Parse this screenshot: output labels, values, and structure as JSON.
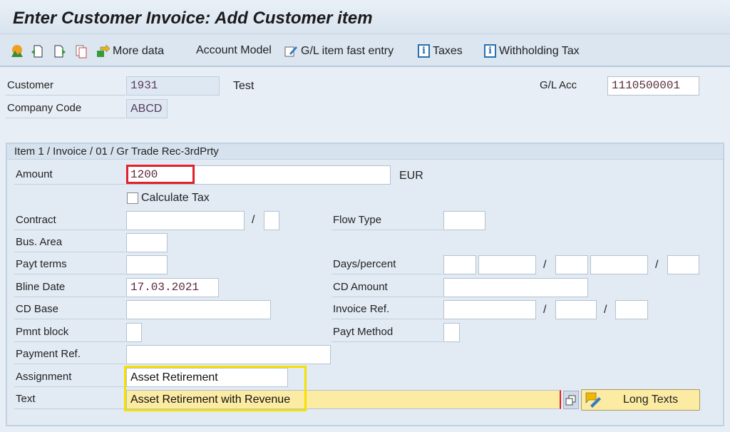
{
  "title": "Enter Customer Invoice: Add Customer item",
  "toolbar": {
    "more_data": "More data",
    "account_model": "Account Model",
    "gl_fast": "G/L item fast entry",
    "taxes": "Taxes",
    "withholding": "Withholding Tax"
  },
  "header": {
    "customer_label": "Customer",
    "customer_value": "1931",
    "customer_name": "Test",
    "company_label": "Company Code",
    "company_value": "ABCD",
    "gl_label": "G/L Acc",
    "gl_value": "1110500001"
  },
  "item": {
    "group_title": "Item 1 / Invoice / 01 / Gr Trade Rec-3rdPrty",
    "amount_label": "Amount",
    "amount_value": "1200",
    "currency": "EUR",
    "calc_tax": "Calculate Tax",
    "calc_tax_checked": false,
    "contract_label": "Contract",
    "bus_area_label": "Bus. Area",
    "payt_terms_label": "Payt terms",
    "bline_label": "Bline Date",
    "bline_value": "17.03.2021",
    "cd_base_label": "CD Base",
    "pmnt_block_label": "Pmnt block",
    "payment_ref_label": "Payment Ref.",
    "assignment_label": "Assignment",
    "assignment_value": "Asset Retirement",
    "text_label": "Text",
    "text_value": "Asset Retirement with Revenue",
    "flow_type_label": "Flow Type",
    "days_percent_label": "Days/percent",
    "cd_amount_label": "CD Amount",
    "invoice_ref_label": "Invoice Ref.",
    "payt_method_label": "Payt Method",
    "slash": "/",
    "long_texts": "Long Texts"
  },
  "colors": {
    "highlight_red": "#e0202a",
    "highlight_yellow": "#f5e000",
    "text_field_bg": "#fbeba3"
  }
}
